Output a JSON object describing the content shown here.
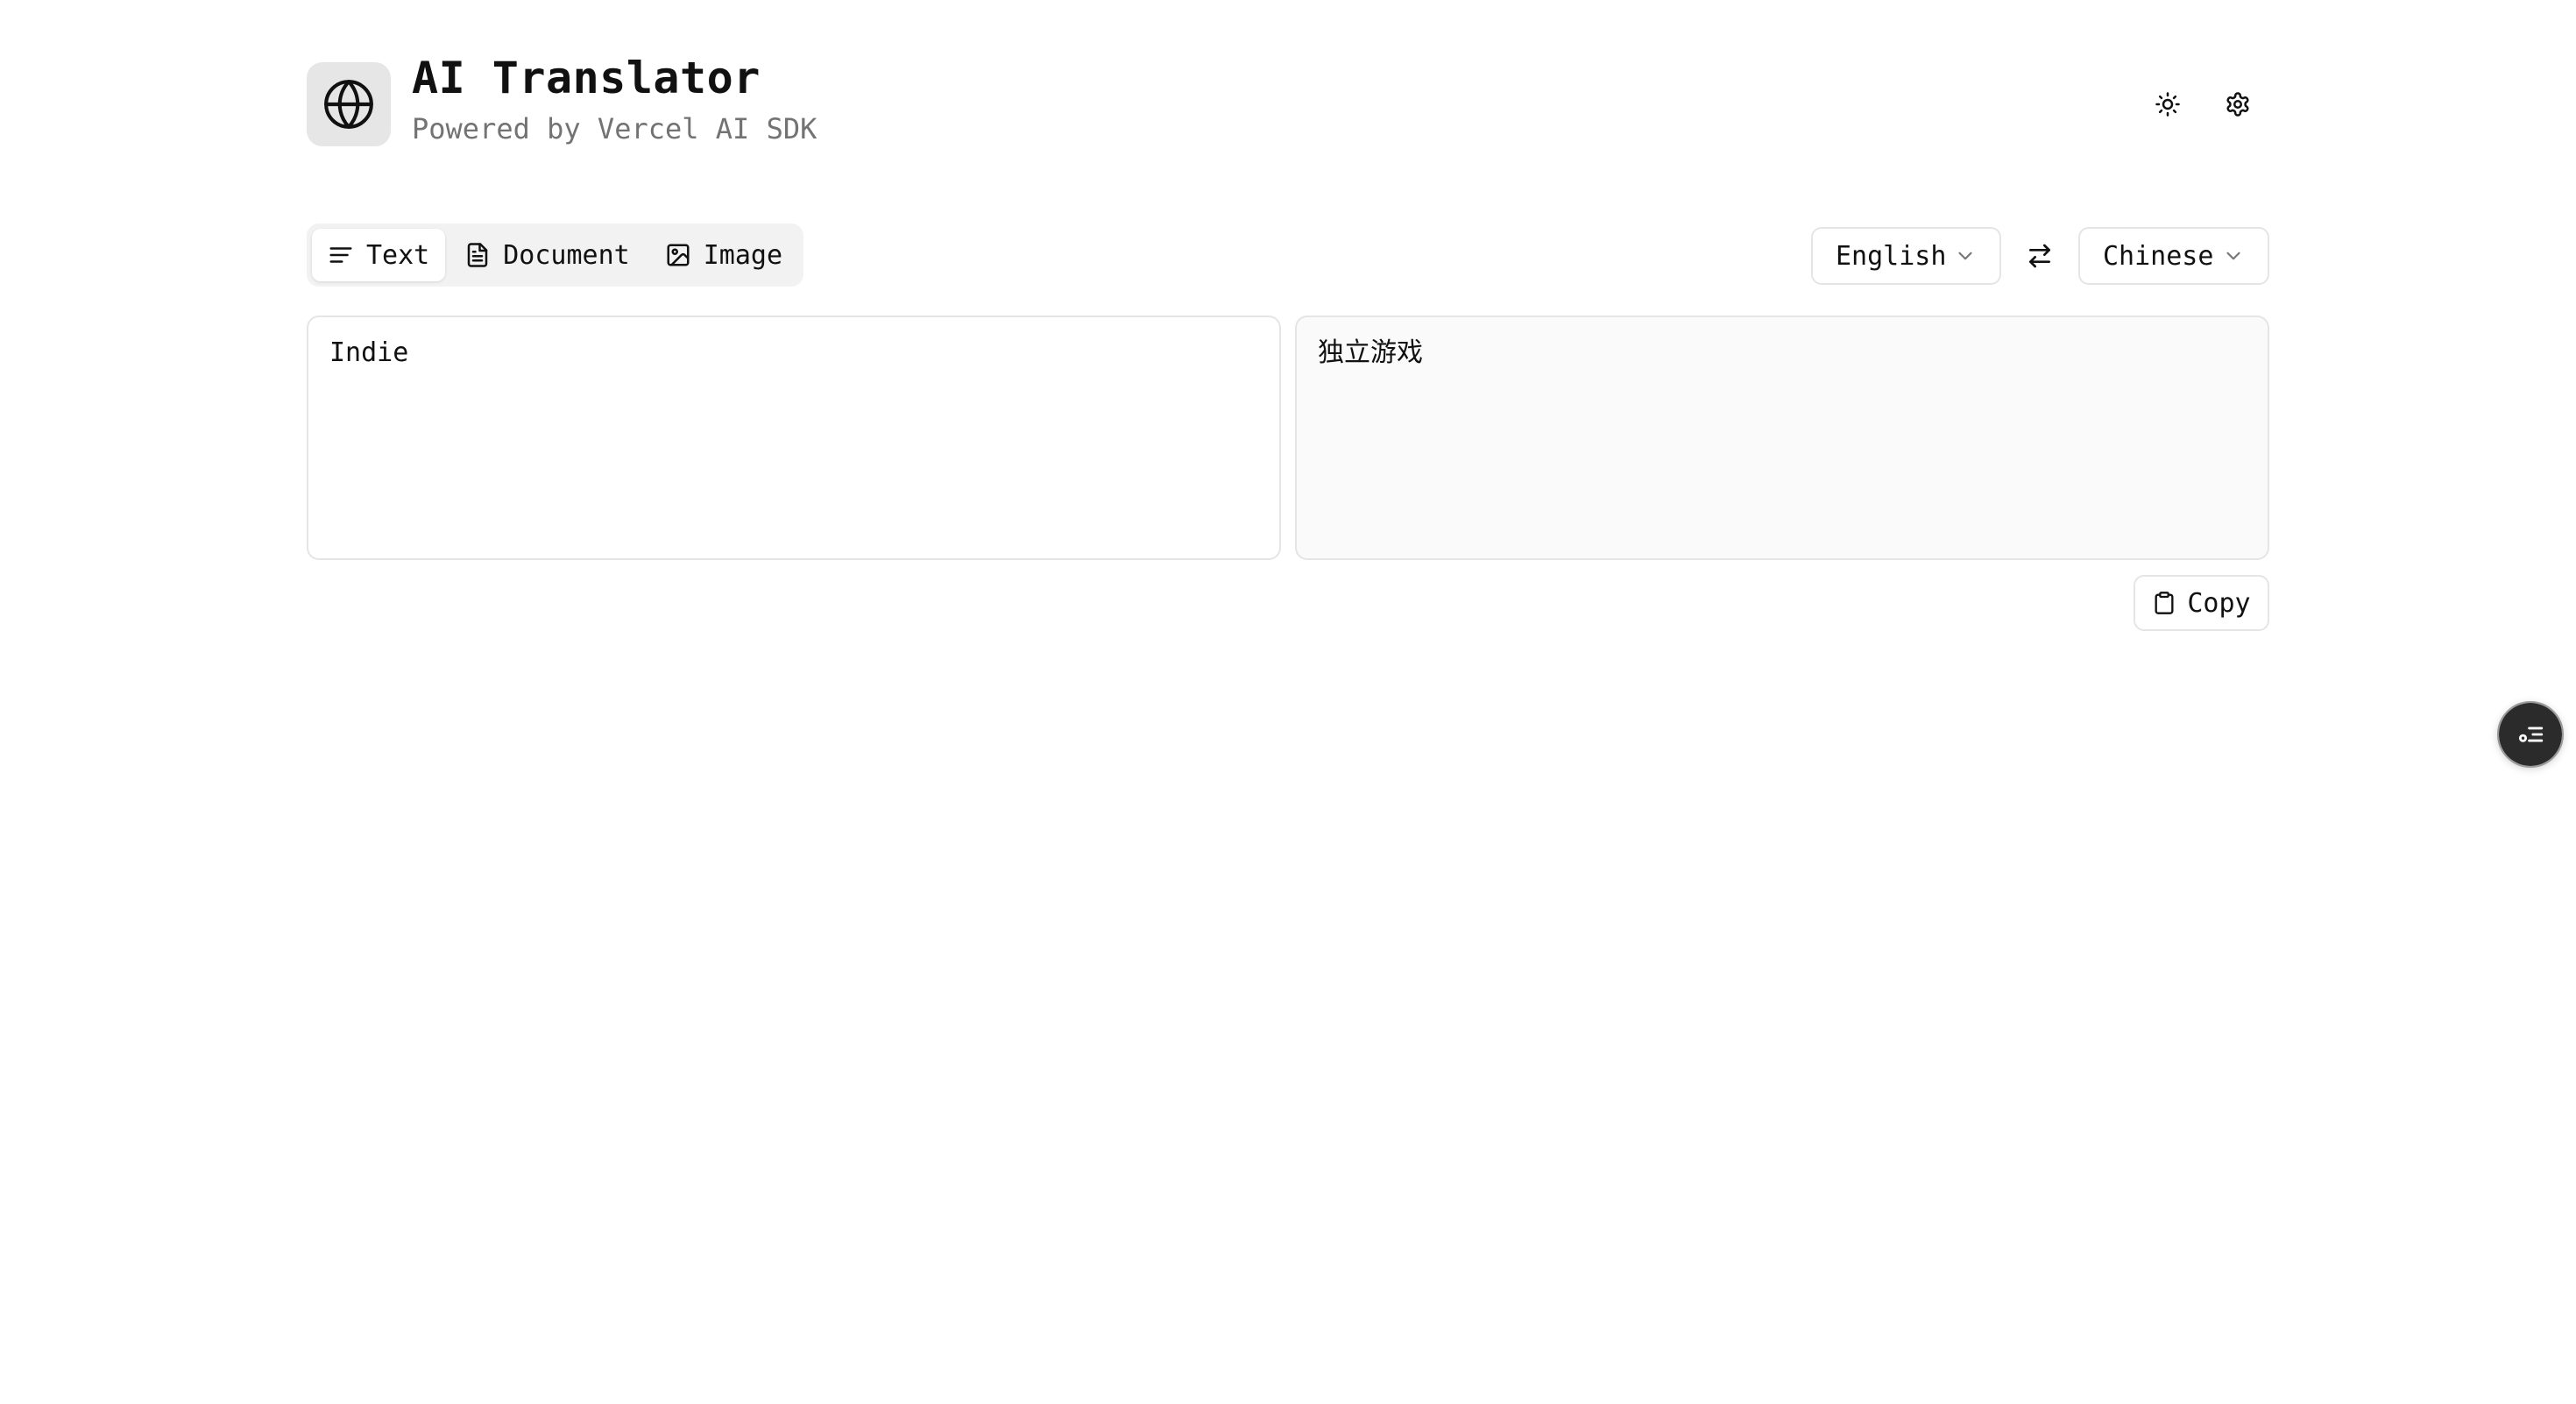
{
  "header": {
    "title": "AI Translator",
    "subtitle": "Powered by Vercel AI SDK",
    "logo_icon": "globe-icon",
    "theme_icon": "sun-icon",
    "settings_icon": "gear-icon"
  },
  "tabs": [
    {
      "label": "Text",
      "icon": "text-lines-icon",
      "active": true
    },
    {
      "label": "Document",
      "icon": "file-icon",
      "active": false
    },
    {
      "label": "Image",
      "icon": "image-icon",
      "active": false
    }
  ],
  "languages": {
    "source": "English",
    "target": "Chinese",
    "swap_icon": "swap-arrows-icon"
  },
  "translation": {
    "source_text": "Indie",
    "target_text": "独立游戏"
  },
  "actions": {
    "copy_label": "Copy",
    "copy_icon": "clipboard-icon"
  },
  "floating_button": {
    "icon": "toggle-list-icon"
  },
  "colors": {
    "background": "#ffffff",
    "logo_background": "#e6e6e6",
    "subtitle_text": "#737373",
    "border": "#e5e5e5",
    "tabs_background": "#f2f2f2",
    "output_panel_background": "#fafafa",
    "fab_background": "#2b2b2b"
  }
}
